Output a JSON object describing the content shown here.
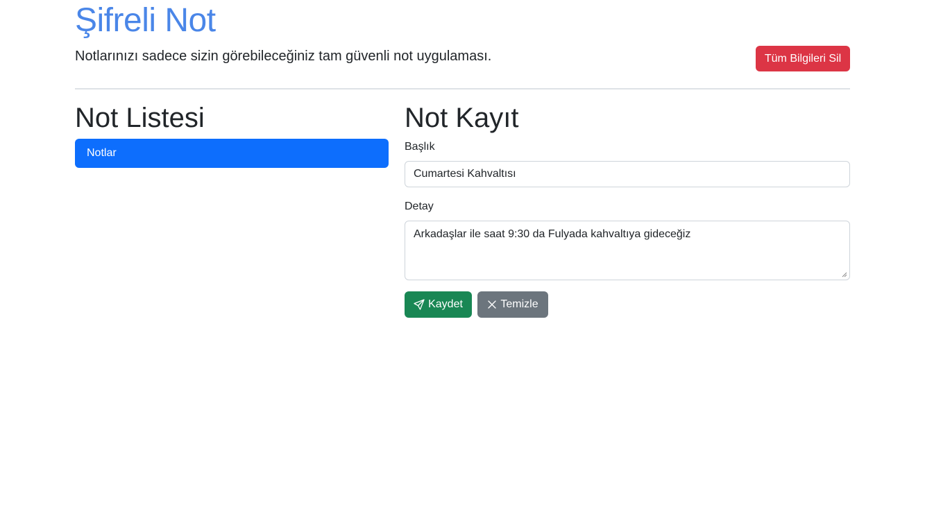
{
  "header": {
    "title": "Şifreli Not",
    "subtitle": "Notlarınızı sadece sizin görebileceğiniz tam güvenli not uygulaması.",
    "delete_all_label": "Tüm Bilgileri Sil"
  },
  "note_list": {
    "heading": "Not Listesi",
    "items": [
      {
        "label": "Notlar",
        "active": true
      }
    ]
  },
  "note_form": {
    "heading": "Not Kayıt",
    "title_label": "Başlık",
    "title_value": "Cumartesi Kahvaltısı",
    "detail_label": "Detay",
    "detail_value": "Arkadaşlar ile saat 9:30 da Fulyada kahvaltıya gideceğiz",
    "save_label": "Kaydet",
    "save_icon": "send-icon",
    "clear_label": "Temizle",
    "clear_icon": "close-icon"
  },
  "colors": {
    "title": "#4a86e8",
    "danger": "#dc3545",
    "primary": "#0d6efd",
    "success": "#198754",
    "secondary": "#6c757d"
  }
}
